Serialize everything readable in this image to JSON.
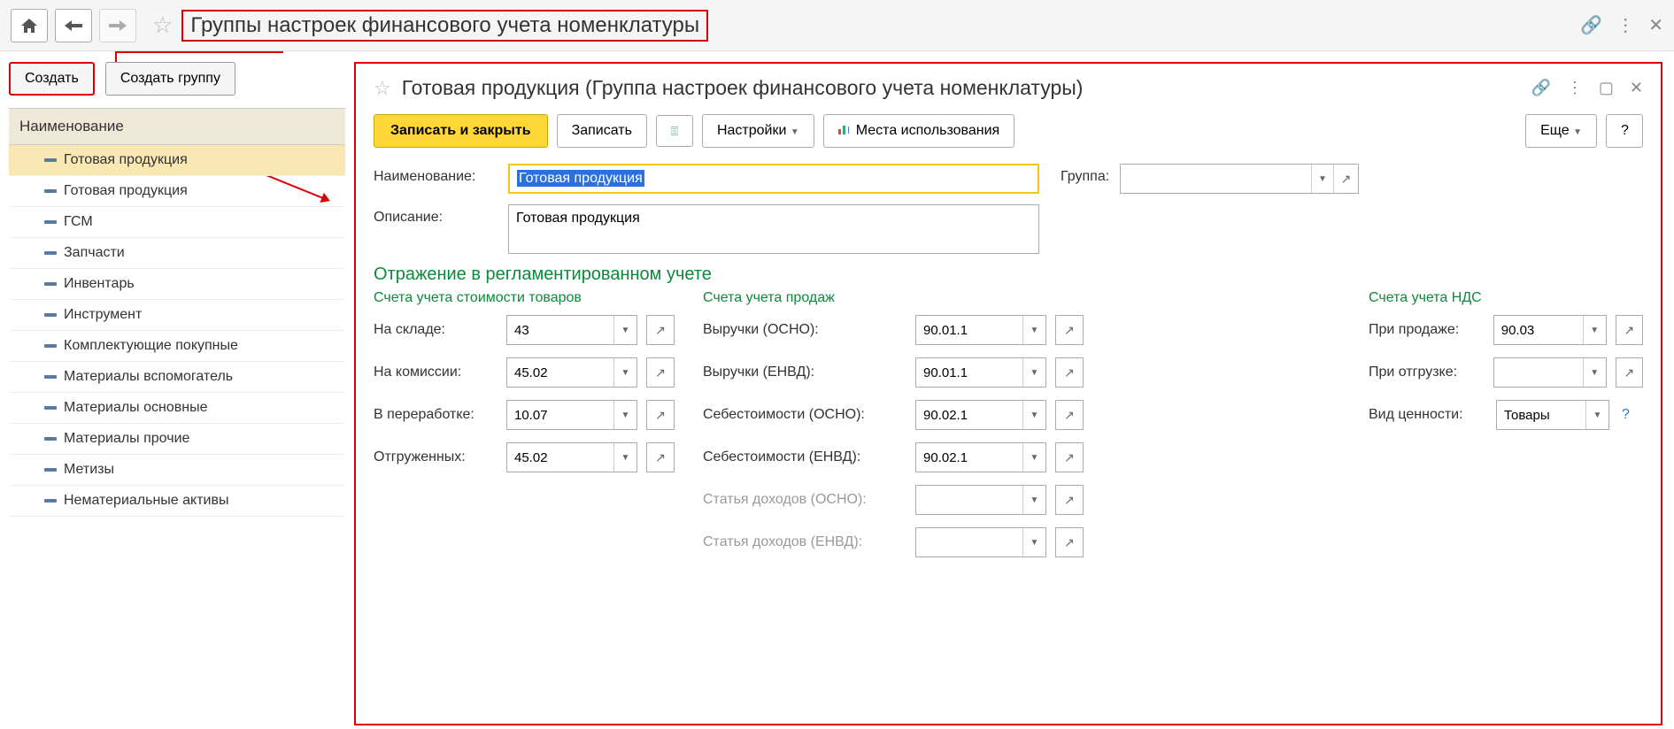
{
  "page_title": "Группы настроек финансового учета номенклатуры",
  "buttons": {
    "create": "Создать",
    "create_group": "Создать группу",
    "save_close": "Записать и закрыть",
    "save": "Записать",
    "settings": "Настройки",
    "usage": "Места использования",
    "more": "Еще",
    "help": "?"
  },
  "left": {
    "header": "Наименование",
    "items": [
      "Готовая продукция",
      "Готовая продукция",
      "ГСМ",
      "Запчасти",
      "Инвентарь",
      "Инструмент",
      "Комплектующие покупные",
      "Материалы вспомогатель",
      "Материалы основные",
      "Материалы прочие",
      "Метизы",
      "Нематериальные активы"
    ]
  },
  "detail": {
    "title": "Готовая продукция (Группа настроек финансового учета номенклатуры)",
    "name_label": "Наименование:",
    "name_value": "Готовая продукция",
    "group_label": "Группа:",
    "group_value": "",
    "desc_label": "Описание:",
    "desc_value": "Готовая продукция",
    "section": "Отражение в регламентированном учете",
    "sub_cost": "Счета учета стоимости товаров",
    "sub_sales": "Счета учета продаж",
    "sub_vat": "Счета учета НДС",
    "cost": {
      "warehouse_label": "На складе:",
      "warehouse": "43",
      "commission_label": "На комиссии:",
      "commission": "45.02",
      "processing_label": "В переработке:",
      "processing": "10.07",
      "shipped_label": "Отгруженных:",
      "shipped": "45.02"
    },
    "sales": {
      "rev_osno_label": "Выручки (ОСНО):",
      "rev_osno": "90.01.1",
      "rev_envd_label": "Выручки (ЕНВД):",
      "rev_envd": "90.01.1",
      "cost_osno_label": "Себестоимости (ОСНО):",
      "cost_osno": "90.02.1",
      "cost_envd_label": "Себестоимости (ЕНВД):",
      "cost_envd": "90.02.1",
      "inc_osno_label": "Статья доходов (ОСНО):",
      "inc_osno": "",
      "inc_envd_label": "Статья доходов (ЕНВД):",
      "inc_envd": ""
    },
    "vat": {
      "on_sale_label": "При продаже:",
      "on_sale": "90.03",
      "on_ship_label": "При отгрузке:",
      "on_ship": "",
      "value_type_label": "Вид ценности:",
      "value_type": "Товары"
    }
  }
}
